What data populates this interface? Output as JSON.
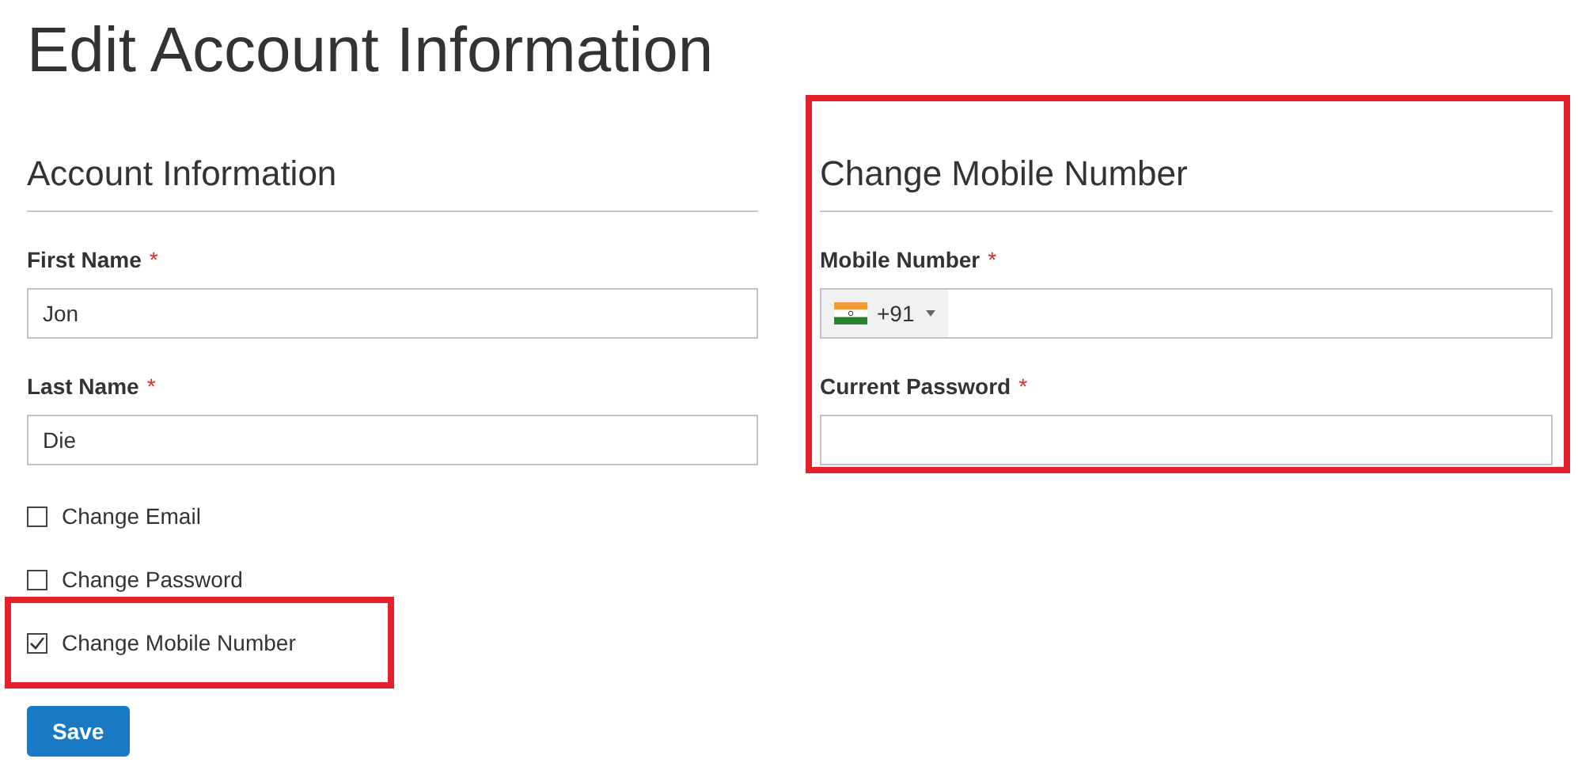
{
  "page_title": "Edit Account Information",
  "account": {
    "heading": "Account Information",
    "fields": [
      {
        "label": "First Name",
        "mark": "*",
        "value": "Jon"
      },
      {
        "label": "Last Name",
        "mark": "*",
        "value": "Die"
      }
    ],
    "options": [
      {
        "label": "Change Email",
        "checked": false,
        "highlighted": false
      },
      {
        "label": "Change Password",
        "checked": false,
        "highlighted": false
      },
      {
        "label": "Change Mobile Number",
        "checked": true,
        "highlighted": true
      }
    ]
  },
  "mobile": {
    "heading": "Change Mobile Number",
    "highlighted": true,
    "phone": {
      "label": "Mobile Number",
      "mark": "*",
      "code": "+91"
    },
    "password": {
      "label": "Current Password",
      "mark": "*"
    }
  },
  "save_button": "Save"
}
